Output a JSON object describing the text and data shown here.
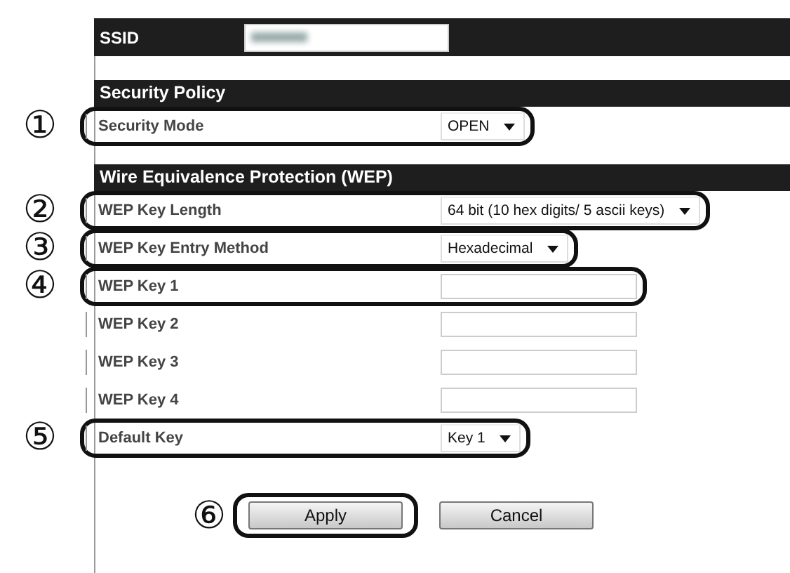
{
  "ssid": {
    "label": "SSID"
  },
  "sections": [
    {
      "title": "Security Policy",
      "rows": [
        {
          "kind": "select",
          "label": "Security Mode",
          "value": "OPEN",
          "marker": "①"
        }
      ]
    },
    {
      "title": "Wire Equivalence Protection (WEP)",
      "rows": [
        {
          "kind": "select",
          "label": "WEP Key Length",
          "value": "64 bit (10 hex digits/ 5 ascii keys)",
          "marker": "②"
        },
        {
          "kind": "select",
          "label": "WEP Key Entry Method",
          "value": "Hexadecimal",
          "marker": "③"
        },
        {
          "kind": "input",
          "label": "WEP Key 1",
          "marker": "④"
        },
        {
          "kind": "input",
          "label": "WEP Key 2"
        },
        {
          "kind": "input",
          "label": "WEP Key 3"
        },
        {
          "kind": "input",
          "label": "WEP Key 4"
        },
        {
          "kind": "select",
          "label": "Default Key",
          "value": "Key 1",
          "marker": "⑤"
        }
      ]
    }
  ],
  "buttons": [
    {
      "label": "Apply",
      "marker": "⑥"
    },
    {
      "label": "Cancel"
    }
  ]
}
